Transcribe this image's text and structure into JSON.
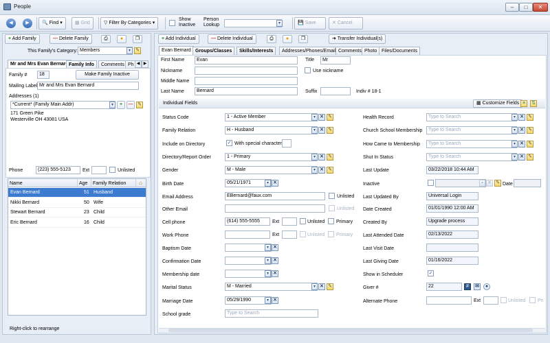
{
  "window": {
    "title": "People"
  },
  "toolbar": {
    "find": "Find",
    "grid": "Grid",
    "filter": "Filter By Categories",
    "show_inactive_line1": "Show",
    "show_inactive_line2": "Inactive",
    "person_lookup_line1": "Person",
    "person_lookup_line2": "Lookup",
    "save": "Save",
    "cancel": "Cancel"
  },
  "family_panel": {
    "add_family": "Add Family",
    "delete_family": "Delete Family",
    "category_label": "This Family's Category:",
    "category_value": "Members",
    "tabs": [
      "Mr and Mrs Evan Bernard",
      "Family Info",
      "Comments",
      "Ph"
    ],
    "family_num_label": "Family #",
    "family_num": "18",
    "make_inactive": "Make Family Inactive",
    "mailing_label_label": "Mailing Label",
    "mailing_label": "Mr and Mrs Evan Bernard",
    "addresses_label": "Addresses (1)",
    "address_select": "*Current* (Family Main Addr)",
    "address_line1": "171 Green Pike",
    "address_line2": "Westerville OH  43081 USA",
    "phone_label": "Phone",
    "phone": "(223) 555-5123",
    "ext_label": "Ext",
    "unlisted_label": "Unlisted",
    "members_headers": [
      "Name",
      "Age",
      "Family Relation"
    ],
    "members": [
      {
        "name": "Evan Bernard",
        "age": "51",
        "relation": "Husband"
      },
      {
        "name": "Nikki Bernard",
        "age": "50",
        "relation": "Wife"
      },
      {
        "name": "Stewart Bernard",
        "age": "23",
        "relation": "Child"
      },
      {
        "name": "Eric Bernard",
        "age": "16",
        "relation": "Child"
      }
    ],
    "rearrange_hint": "Right-click to rearrange"
  },
  "individual_panel": {
    "add_individual": "Add Individual",
    "delete_individual": "Delete Individual",
    "transfer": "Transfer Individual(s)",
    "tabs": [
      "Evan Bernard",
      "Groups/Classes",
      "Skills/Interests",
      "Addresses/Phones/Email",
      "Comments",
      "Photo",
      "Files/Documents"
    ],
    "first_name_label": "First Name",
    "first_name": "Evan",
    "title_label": "Title",
    "title": "Mr",
    "nickname_label": "Nickname",
    "use_nickname": "Use nickname",
    "middle_name_label": "Middle Name",
    "last_name_label": "Last Name",
    "last_name": "Bernard",
    "suffix_label": "Suffix",
    "indiv_num": "Indiv # 18-1",
    "fields_title": "Individual Fields",
    "customize": "Customize Fields",
    "left_fields": [
      {
        "label": "Status Code",
        "value": "1 - Active Member"
      },
      {
        "label": "Family Relation",
        "value": "H - Husband"
      },
      {
        "label": "Include on Directory",
        "value": "With special character"
      },
      {
        "label": "Directory/Report Order",
        "value": "1 - Primary"
      },
      {
        "label": "Gender",
        "value": "M - Male"
      },
      {
        "label": "Birth Date",
        "value": "05/21/1971"
      },
      {
        "label": "Email Address",
        "value": "EBernard@faux.com"
      },
      {
        "label": "Other Email",
        "value": ""
      },
      {
        "label": "Cell phone",
        "value": "(614) 555-5555"
      },
      {
        "label": "Work Phone",
        "value": ""
      },
      {
        "label": "Baptism Date",
        "value": ""
      },
      {
        "label": "Confirmation Date",
        "value": ""
      },
      {
        "label": "Membership date",
        "value": ""
      },
      {
        "label": "Marital Status",
        "value": "M - Married"
      },
      {
        "label": "Marriage Date",
        "value": "05/29/1990"
      },
      {
        "label": "School grade",
        "value": ""
      }
    ],
    "ext_label": "Ext",
    "unlisted_label": "Unlisted",
    "primary_label": "Primary",
    "type_to_search": "Type to Search",
    "right_fields": [
      {
        "label": "Health Record",
        "value": ""
      },
      {
        "label": "Church School Membership",
        "value": ""
      },
      {
        "label": "How Came to Membership",
        "value": ""
      },
      {
        "label": "Shut In Status",
        "value": ""
      },
      {
        "label": "Last Update",
        "value": "03/22/2018 10:44 AM"
      },
      {
        "label": "Inactive",
        "value": ""
      },
      {
        "label": "Last Updated By",
        "value": "Universal Login"
      },
      {
        "label": "Date Created",
        "value": "01/01/1990 12:00 AM"
      },
      {
        "label": "Created By",
        "value": "Upgrade process"
      },
      {
        "label": "Last Attended Date",
        "value": "02/13/2022"
      },
      {
        "label": "Last Visit Date",
        "value": ""
      },
      {
        "label": "Last Giving Date",
        "value": "01/16/2022"
      },
      {
        "label": "Show in Scheduler",
        "value": ""
      },
      {
        "label": "Giver #",
        "value": "22"
      },
      {
        "label": "Alternate Phone",
        "value": ""
      }
    ],
    "date_label": "Date"
  }
}
